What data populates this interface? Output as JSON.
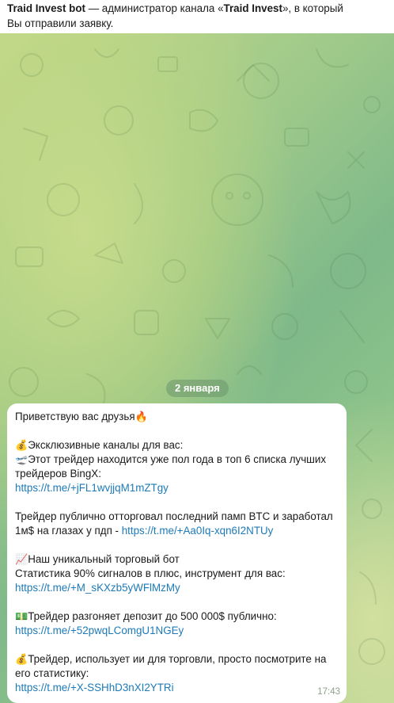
{
  "header": {
    "bot_name": "Traid Invest bot",
    "text_1": " — администратор канала «",
    "channel_name": "Traid Invest",
    "text_2": "», в который",
    "text_3": "Вы отправили заявку."
  },
  "chat": {
    "date_label": "2 января",
    "message": {
      "greeting": "Приветствую вас друзья",
      "greeting_emoji": "🔥",
      "channels_emoji": "💰",
      "channels_title": "Эксклюзивные каналы для вас:",
      "trader1_emoji": "🛫",
      "trader1_line1": "Этот трейдер находится уже пол года в топ 6 списка лучших",
      "trader1_line2": "трейдеров BingX:",
      "link1": "https://t.me/+jFL1wvjjqM1mZTgy",
      "pump_line1": "Трейдер публично отторговал последний памп BTC и заработал",
      "pump_line2_text": "1м$ на глазах у пдп - ",
      "link2": "https://t.me/+Aa0Iq-xqn6I2NTUy",
      "bot_emoji": "📈",
      "bot_title": "Наш уникальный торговый бот",
      "bot_stats": "Статистика 90% сигналов в плюс, инструмент для вас:",
      "link3": "https://t.me/+M_sKXzb5yWFlMzMy",
      "deposit_emoji": "💵",
      "deposit_text": "Трейдер разгоняет депозит до 500 000$ публично:",
      "link4": "https://t.me/+52pwqLComgU1NGEy",
      "ai_emoji": "💰",
      "ai_line1": "Трейдер, использует ии для торговли, просто посмотрите на",
      "ai_line2": "его статистику:",
      "link5": "https://t.me/+X-SSHhD3nXI2YTRi",
      "time": "17:43"
    }
  }
}
